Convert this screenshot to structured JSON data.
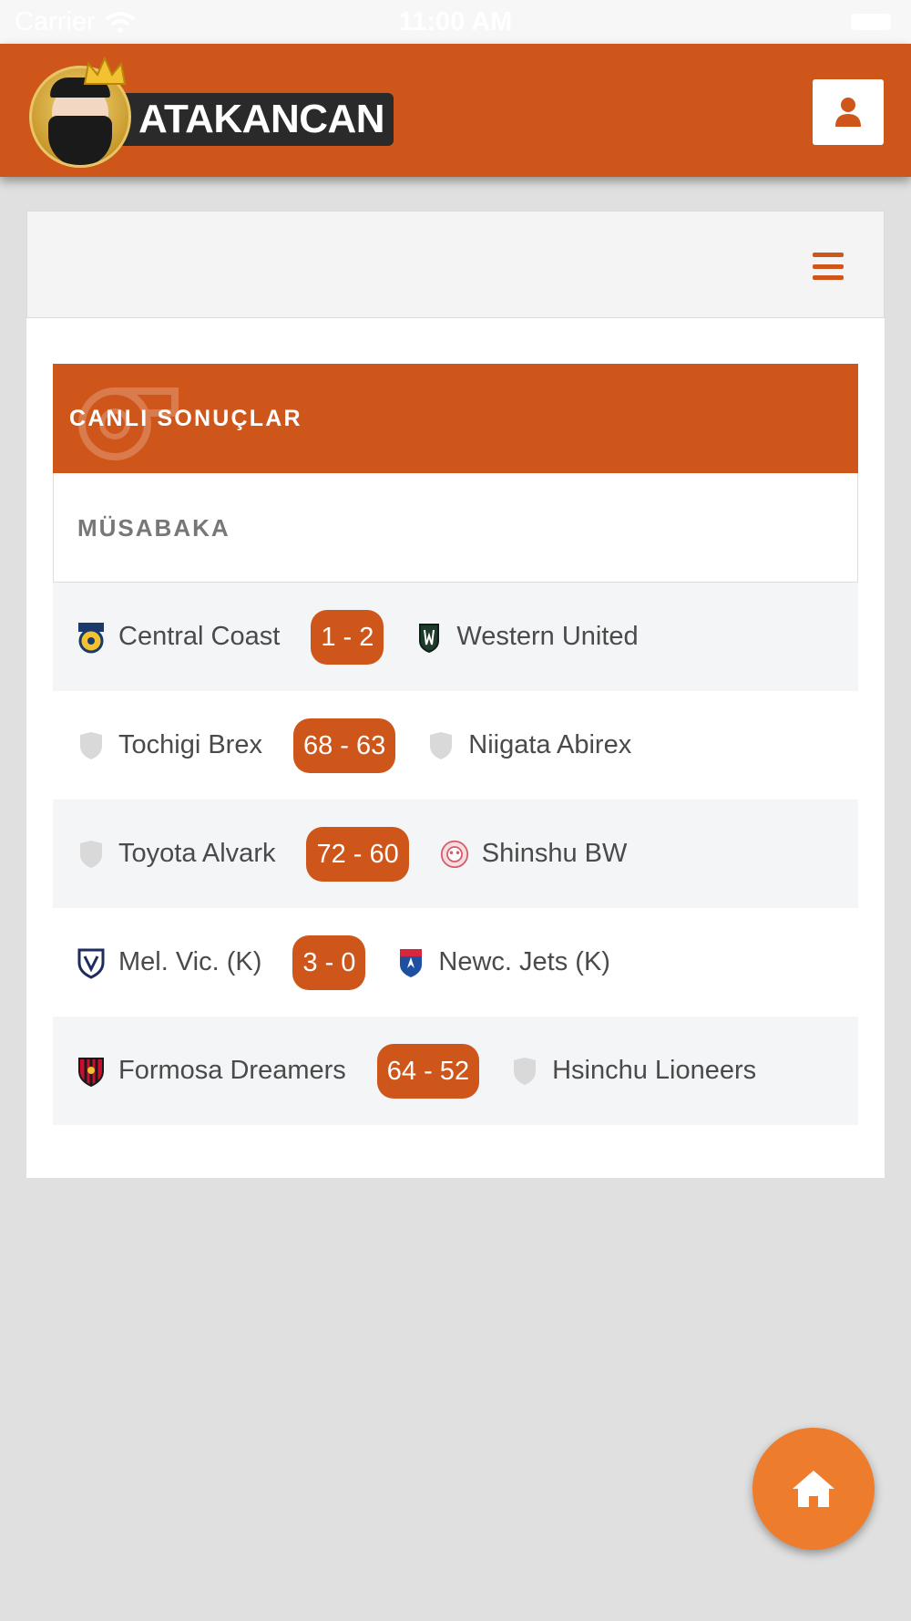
{
  "statusbar": {
    "carrier": "Carrier",
    "time": "11:00 AM"
  },
  "brand": {
    "logo_text": "ATAKANCAN",
    "accent": "#cf561b",
    "fab_color": "#ee7c2d"
  },
  "header": {
    "user_icon": "user-icon"
  },
  "nav": {
    "menu_icon": "hamburger-menu-icon"
  },
  "live": {
    "title": "CANLI SONUÇLAR",
    "column_header": "MÜSABAKA"
  },
  "matches": [
    {
      "home": "Central Coast",
      "home_icon": "central-coast-crest",
      "score": "1 - 2",
      "away": "Western United",
      "away_icon": "western-united-crest"
    },
    {
      "home": "Tochigi Brex",
      "home_icon": "shield-icon",
      "score": "68 - 63",
      "away": "Niigata Abirex",
      "away_icon": "shield-icon"
    },
    {
      "home": "Toyota Alvark",
      "home_icon": "shield-icon",
      "score": "72 - 60",
      "away": "Shinshu BW",
      "away_icon": "shinshu-crest"
    },
    {
      "home": "Mel. Vic. (K)",
      "home_icon": "melbourne-victory-crest",
      "score": "3 - 0",
      "away": "Newc. Jets (K)",
      "away_icon": "newcastle-jets-crest"
    },
    {
      "home": "Formosa Dreamers",
      "home_icon": "formosa-crest",
      "score": "64 - 52",
      "away": "Hsinchu Lioneers",
      "away_icon": "shield-icon"
    }
  ],
  "fab": {
    "icon": "home-icon"
  }
}
